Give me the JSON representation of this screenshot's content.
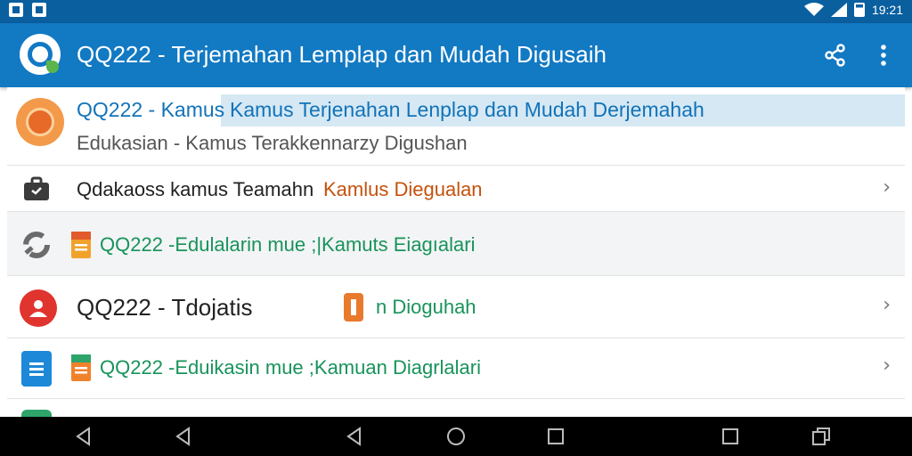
{
  "status_bar": {
    "time": "19:21",
    "icons": [
      "notification-icon",
      "notification-icon",
      "wifi-icon",
      "signal-icon",
      "battery-icon"
    ]
  },
  "app_bar": {
    "title": "QQ222 - Terjemahan Lemplap dan Mudah Digusaih",
    "actions": [
      "share-icon",
      "more-vert-icon"
    ]
  },
  "list": {
    "items": [
      {
        "title_part1": "QQ222 - Kamus",
        "title_part2": "Kamus Terjenahan Lenplap dan Mudah Derjemahah",
        "subtitle": "Edukasian - Kamus Terakkennarzy Digushan",
        "icon": "dictionary-orange-icon"
      },
      {
        "title_part1": "Qdakaoss kamus Teamahn",
        "title_part2": "Kamlus Diegualan",
        "icon": "briefcase-icon"
      },
      {
        "title": "QQ222 -Edulalarin mue ;|Kamuts Eiagıalari",
        "icon": "refresh-icon",
        "sub_icon": "file-icon"
      },
      {
        "title_part1": "QQ222 - Tdojatis",
        "title_part2": "n Dioguhah",
        "icon": "person-icon",
        "badge_icon": "info-badge-icon"
      },
      {
        "title": "QQ222 -Eduikasin mue ;Kamuan Diagrlalari",
        "icon": "document-icon",
        "sub_icon": "file-icon"
      }
    ]
  },
  "colors": {
    "status_bar": "#0a5f9f",
    "app_bar": "#1279c3",
    "link_blue": "#1273b8",
    "green_text": "#18935a",
    "orange_text": "#c4520d",
    "highlight": "#d5e8f4"
  },
  "nav_bar": {
    "buttons": [
      "back-icon",
      "back-icon",
      "back-icon",
      "home-icon",
      "recents-icon",
      "recents-icon",
      "overview-icon"
    ]
  }
}
